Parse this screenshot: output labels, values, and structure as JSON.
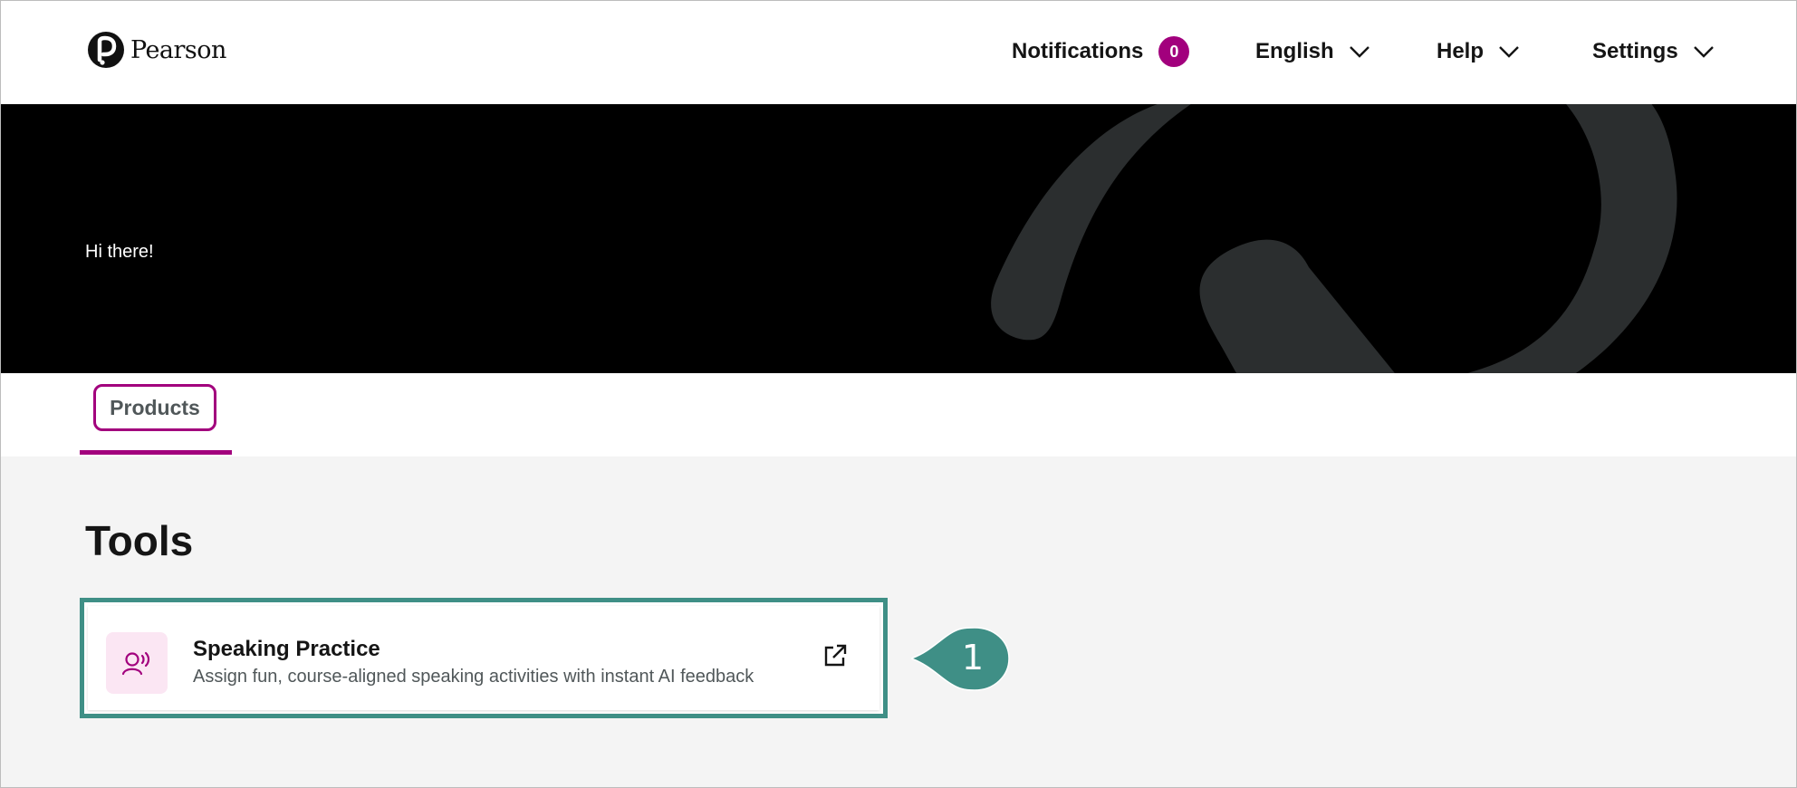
{
  "header": {
    "brand": "Pearson",
    "nav": {
      "notifications_label": "Notifications",
      "notifications_count": "0",
      "language_label": "English",
      "help_label": "Help",
      "settings_label": "Settings"
    }
  },
  "hero": {
    "greeting": "Hi there!"
  },
  "tabs": [
    {
      "label": "Products",
      "active": true
    }
  ],
  "main": {
    "section_title": "Tools",
    "tools": [
      {
        "title": "Speaking Practice",
        "description": "Assign fun, course-aligned speaking activities with instant AI feedback",
        "icon": "speaking-icon",
        "action_icon": "external-link-icon"
      }
    ]
  },
  "annotation": {
    "callout_number": "1",
    "color": "#3f8f86"
  },
  "colors": {
    "accent": "#a2007d",
    "callout": "#3f8f86",
    "hero_bg": "#000000",
    "hero_shape": "#2b2e2f"
  }
}
